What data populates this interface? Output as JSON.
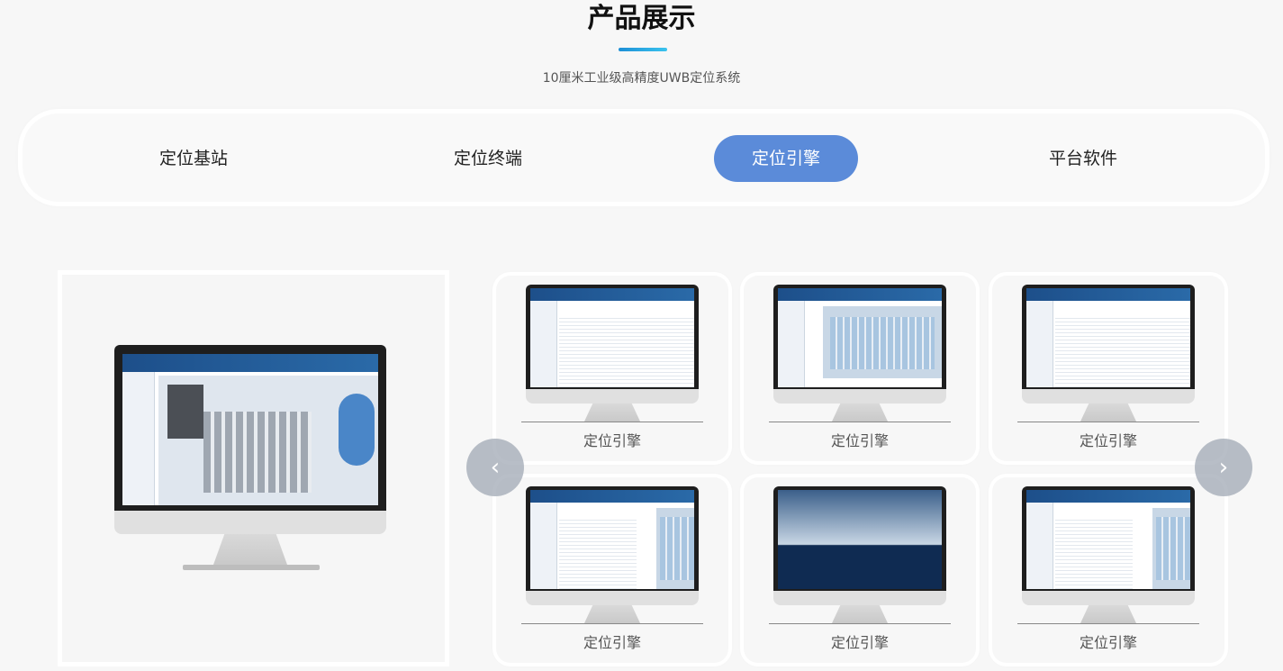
{
  "header": {
    "title": "产品展示",
    "subtitle": "10厘米工业级高精度UWB定位系统",
    "accent_color": "#2aa6e3"
  },
  "tabs": [
    {
      "label": "定位基站",
      "active": false
    },
    {
      "label": "定位终端",
      "active": false
    },
    {
      "label": "定位引擎",
      "active": true
    },
    {
      "label": "平台软件",
      "active": false
    }
  ],
  "active_tab_color": "#5b8bd9",
  "gallery": {
    "prev_icon": "chevron-left-icon",
    "next_icon": "chevron-right-icon",
    "prev_glyph": "‹",
    "next_glyph": "›",
    "cards": [
      {
        "label": "定位引擎",
        "screen": "table"
      },
      {
        "label": "定位引擎",
        "screen": "map"
      },
      {
        "label": "定位引擎",
        "screen": "table"
      },
      {
        "label": "定位引擎",
        "screen": "table-map"
      },
      {
        "label": "定位引擎",
        "screen": "3d"
      },
      {
        "label": "定位引擎",
        "screen": "table-map"
      }
    ]
  }
}
